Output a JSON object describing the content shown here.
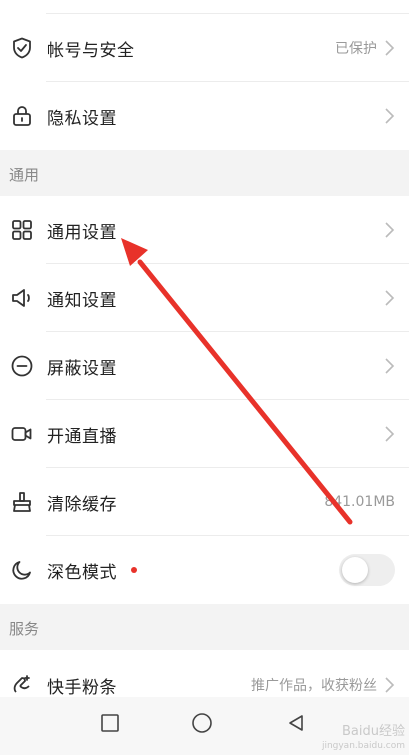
{
  "rows": {
    "account_security": {
      "label": "帐号与安全",
      "value": "已保护",
      "icon": "shield-check-icon"
    },
    "privacy": {
      "label": "隐私设置",
      "icon": "lock-icon"
    },
    "general_settings": {
      "label": "通用设置",
      "icon": "grid-icon"
    },
    "notification_settings": {
      "label": "通知设置",
      "icon": "speaker-icon"
    },
    "block_settings": {
      "label": "屏蔽设置",
      "icon": "minus-circle-icon"
    },
    "open_live": {
      "label": "开通直播",
      "icon": "video-camera-icon"
    },
    "clear_cache": {
      "label": "清除缓存",
      "value": "841.01MB",
      "icon": "brush-icon"
    },
    "dark_mode": {
      "label": "深色模式",
      "icon": "moon-icon",
      "toggle_on": false
    },
    "kuaishou_fen_tiao": {
      "label": "快手粉条",
      "value": "推广作品，收获粉丝",
      "icon": "rocket-icon"
    }
  },
  "sections": {
    "general": "通用",
    "service": "服务"
  },
  "navbar": {
    "recents_icon": "square-icon",
    "home_icon": "circle-icon",
    "back_icon": "triangle-back-icon"
  },
  "watermark": {
    "brand": "Baidu经验",
    "url": "jingyan.baidu.com"
  },
  "colors": {
    "accent_red": "#e8322a",
    "section_bg": "#f3f3f3",
    "muted_text": "#9a9a9a"
  }
}
